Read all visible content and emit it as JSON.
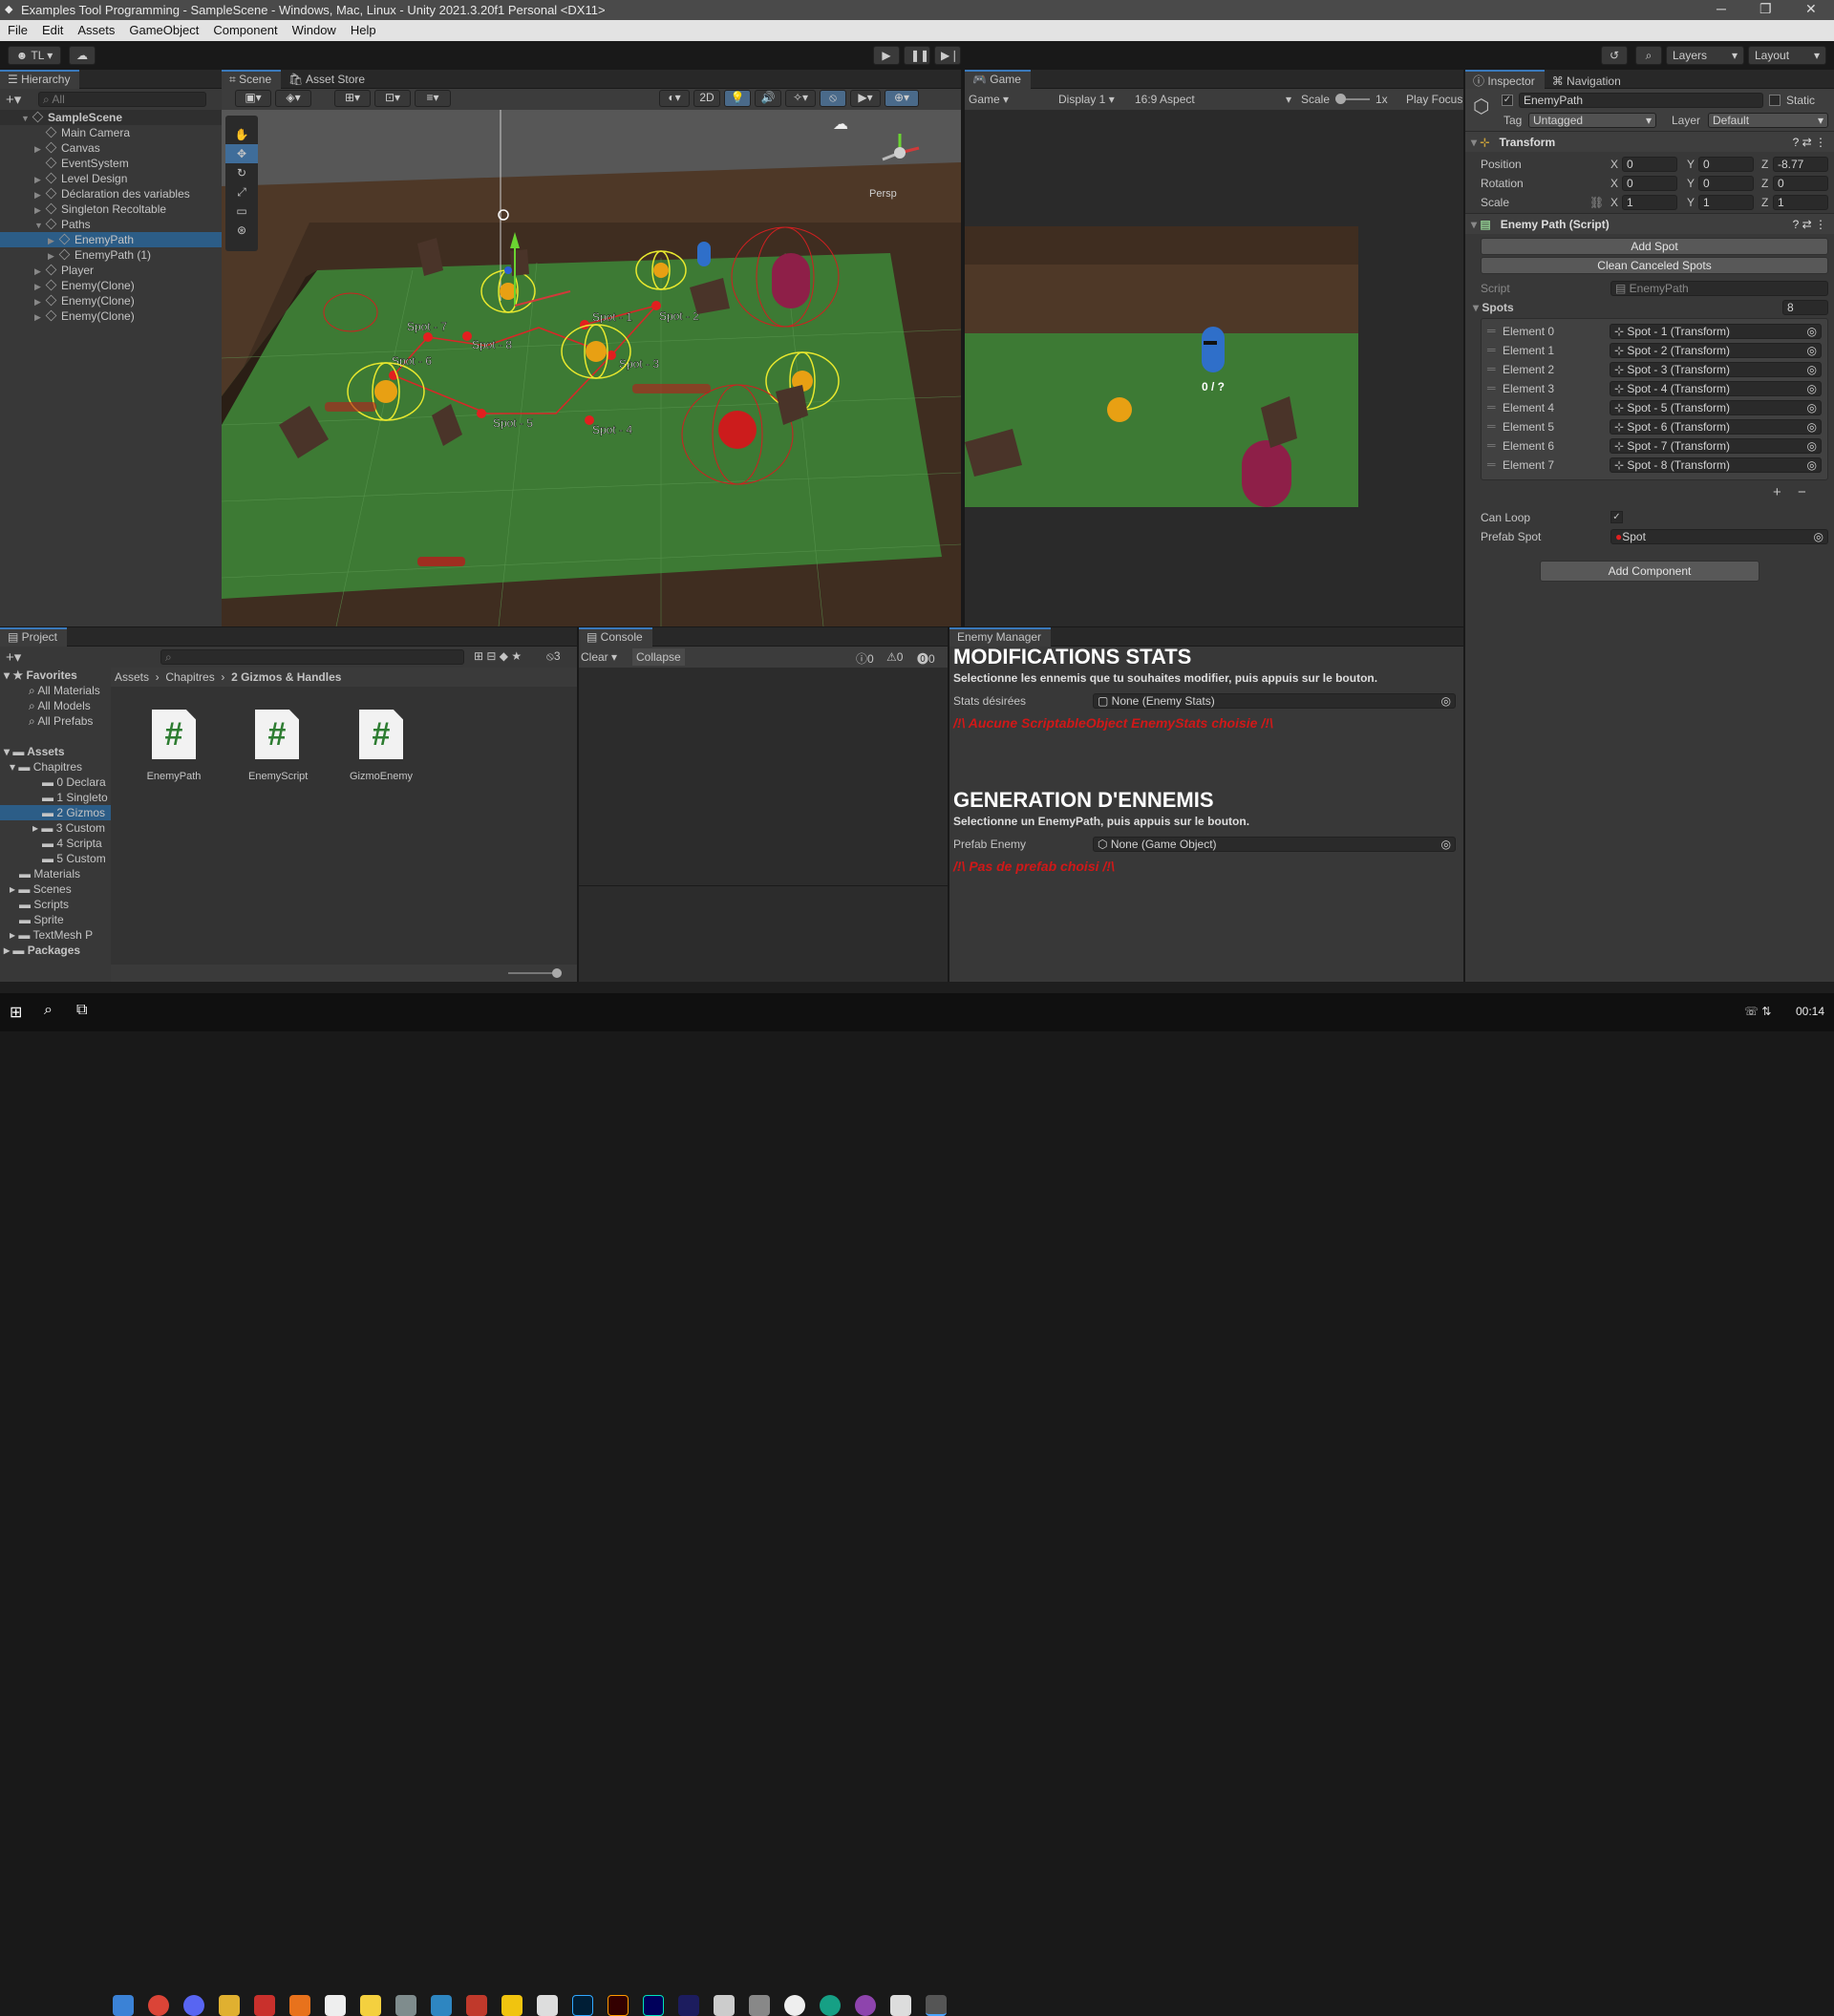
{
  "window": {
    "title": "Examples Tool Programming - SampleScene - Windows, Mac, Linux - Unity 2021.3.20f1 Personal <DX11>"
  },
  "menu": [
    "File",
    "Edit",
    "Assets",
    "GameObject",
    "Component",
    "Window",
    "Help"
  ],
  "toolbar": {
    "account": "TL",
    "layers": "Layers",
    "layout": "Layout"
  },
  "hierarchy": {
    "tab": "Hierarchy",
    "search_placeholder": "All",
    "items": [
      {
        "label": "SampleScene",
        "depth": 0
      },
      {
        "label": "Main Camera",
        "depth": 1
      },
      {
        "label": "Canvas",
        "depth": 1
      },
      {
        "label": "EventSystem",
        "depth": 1
      },
      {
        "label": "Level Design",
        "depth": 1
      },
      {
        "label": "Déclaration des variables",
        "depth": 1
      },
      {
        "label": "Singleton Recoltable",
        "depth": 1
      },
      {
        "label": "Paths",
        "depth": 1
      },
      {
        "label": "EnemyPath",
        "depth": 2
      },
      {
        "label": "EnemyPath (1)",
        "depth": 2
      },
      {
        "label": "Player",
        "depth": 1
      },
      {
        "label": "Enemy(Clone)",
        "depth": 1
      },
      {
        "label": "Enemy(Clone)",
        "depth": 1
      },
      {
        "label": "Enemy(Clone)",
        "depth": 1
      }
    ]
  },
  "scene": {
    "tabs": [
      "Scene",
      "Asset Store"
    ],
    "btn_2d": "2D",
    "persp": "Persp",
    "spots": [
      "Spot - 1",
      "Spot - 2",
      "Spot - 3",
      "Spot - 4",
      "Spot - 5",
      "Spot - 6",
      "Spot - 7",
      "Spot - 8"
    ]
  },
  "game": {
    "tab": "Game",
    "mode": "Game",
    "display": "Display 1",
    "aspect": "16:9 Aspect",
    "scale_label": "Scale",
    "scale_value": "1x",
    "play_focus": "Play Focus",
    "hud": "0 / ?"
  },
  "inspector": {
    "tabs": [
      "Inspector",
      "Navigation"
    ],
    "object_name": "EnemyPath",
    "static_label": "Static",
    "tag_label": "Tag",
    "tag_value": "Untagged",
    "layer_label": "Layer",
    "layer_value": "Default",
    "transform": {
      "title": "Transform",
      "position": {
        "label": "Position",
        "x": "0",
        "y": "0",
        "z": "-8.77"
      },
      "rotation": {
        "label": "Rotation",
        "x": "0",
        "y": "0",
        "z": "0"
      },
      "scale": {
        "label": "Scale",
        "x": "1",
        "y": "1",
        "z": "1"
      }
    },
    "script_comp": {
      "title": "Enemy Path (Script)",
      "add_spot": "Add Spot",
      "clean": "Clean Canceled Spots",
      "script_label": "Script",
      "script_value": "EnemyPath",
      "spots_label": "Spots",
      "spots_count": "8",
      "elements": [
        {
          "label": "Element 0",
          "value": "Spot - 1 (Transform)"
        },
        {
          "label": "Element 1",
          "value": "Spot - 2 (Transform)"
        },
        {
          "label": "Element 2",
          "value": "Spot - 3 (Transform)"
        },
        {
          "label": "Element 3",
          "value": "Spot - 4 (Transform)"
        },
        {
          "label": "Element 4",
          "value": "Spot - 5 (Transform)"
        },
        {
          "label": "Element 5",
          "value": "Spot - 6 (Transform)"
        },
        {
          "label": "Element 6",
          "value": "Spot - 7 (Transform)"
        },
        {
          "label": "Element 7",
          "value": "Spot - 8 (Transform)"
        }
      ],
      "can_loop_label": "Can Loop",
      "prefab_spot_label": "Prefab Spot",
      "prefab_spot_value": "Spot"
    },
    "add_component": "Add Component"
  },
  "project": {
    "tab": "Project",
    "favorites": "Favorites",
    "fav_items": [
      "All Materials",
      "All Models",
      "All Prefabs"
    ],
    "assets": "Assets",
    "tree": [
      "Chapitres",
      "0 Declara",
      "1 Singleto",
      "2 Gizmos",
      "3 Custom",
      "4 Scripta",
      "5 Custom",
      "Materials",
      "Scenes",
      "Scripts",
      "Sprite",
      "TextMesh P"
    ],
    "packages": "Packages",
    "breadcrumb": [
      "Assets",
      "Chapitres",
      "2 Gizmos & Handles"
    ],
    "files": [
      "EnemyPath",
      "EnemyScript",
      "GizmoEnemy"
    ],
    "hidden_count": "3"
  },
  "console": {
    "tab": "Console",
    "clear": "Clear",
    "collapse": "Collapse",
    "counts": [
      "0",
      "0",
      "0"
    ]
  },
  "enemy_manager": {
    "tab": "Enemy Manager",
    "h1": "MODIFICATIONS STATS",
    "d1": "Selectionne les ennemis que tu souhaites modifier, puis appuis sur le bouton.",
    "stats_label": "Stats désirées",
    "stats_value": "None (Enemy Stats)",
    "err1": "/!\\ Aucune ScriptableObject EnemyStats choisie /!\\",
    "h2": "GENERATION D'ENNEMIS",
    "d2": "Selectionne un EnemyPath, puis appuis sur le bouton.",
    "prefab_label": "Prefab Enemy",
    "prefab_value": "None (Game Object)",
    "err2": "/!\\ Pas de prefab choisi /!\\"
  },
  "taskbar": {
    "time": "00:14"
  }
}
